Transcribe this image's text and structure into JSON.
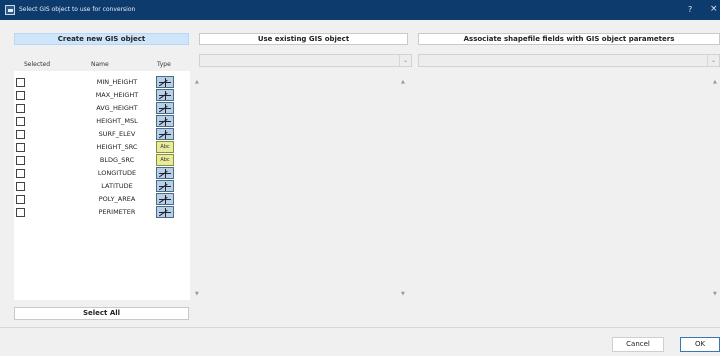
{
  "window": {
    "title": "Select GIS object to use for conversion",
    "help_glyph": "?",
    "close_glyph": "×"
  },
  "tabs": [
    {
      "label": "Create new GIS object",
      "active": true
    },
    {
      "label": "Use existing GIS object",
      "active": false
    },
    {
      "label": "Associate shapefile fields with GIS object parameters",
      "active": false
    }
  ],
  "columns": {
    "selected": "Selected",
    "name": "Name",
    "type": "Type"
  },
  "fields": [
    {
      "name": "MIN_HEIGHT",
      "type": "numeric-icon",
      "type_label": ""
    },
    {
      "name": "MAX_HEIGHT",
      "type": "numeric-icon",
      "type_label": ""
    },
    {
      "name": "AVG_HEIGHT",
      "type": "numeric-icon",
      "type_label": ""
    },
    {
      "name": "HEIGHT_MSL",
      "type": "numeric-icon",
      "type_label": ""
    },
    {
      "name": "SURF_ELEV",
      "type": "numeric-icon",
      "type_label": ""
    },
    {
      "name": "HEIGHT_SRC",
      "type": "text-icon",
      "type_label": "Abc"
    },
    {
      "name": "BLDG_SRC",
      "type": "text-icon",
      "type_label": "Abc"
    },
    {
      "name": "LONGITUDE",
      "type": "numeric-icon",
      "type_label": ""
    },
    {
      "name": "LATITUDE",
      "type": "numeric-icon",
      "type_label": ""
    },
    {
      "name": "POLY_AREA",
      "type": "numeric-icon",
      "type_label": ""
    },
    {
      "name": "PERIMETER",
      "type": "numeric-icon",
      "type_label": ""
    }
  ],
  "buttons": {
    "select_all": "Select All",
    "cancel": "Cancel",
    "ok": "OK"
  },
  "colors": {
    "titlebar": "#0e3b6e",
    "active_tab": "#cfe5fb",
    "text_type": "#e7eb9b",
    "numeric_type": "#b8d0e6"
  }
}
